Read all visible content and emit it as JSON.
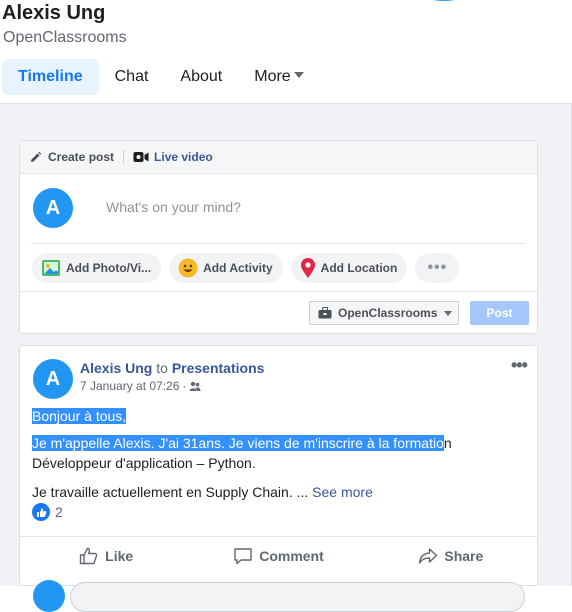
{
  "profile": {
    "name": "Alexis Ung",
    "page": "OpenClassrooms"
  },
  "tabs": [
    {
      "label": "Timeline",
      "active": true
    },
    {
      "label": "Chat"
    },
    {
      "label": "About"
    },
    {
      "label": "More"
    }
  ],
  "composer": {
    "create_post": "Create post",
    "live_video": "Live video",
    "avatar_letter": "A",
    "placeholder": "What's on your mind?",
    "chips": [
      "Add Photo/Vi...",
      "Add Activity",
      "Add Location"
    ],
    "more_chip": "•••",
    "page_selector": "OpenClassrooms",
    "post_button": "Post"
  },
  "post": {
    "avatar_letter": "A",
    "author": "Alexis Ung",
    "connector": "to",
    "target": "Presentations",
    "timestamp": "7 January at 07:26",
    "more_menu": "•••",
    "line1": "Bonjour à tous,",
    "line2_highlight": "Je m'appelle Alexis. J'ai 31ans. Je viens de m'inscrire à la formatio",
    "line2_rest": "n",
    "line3": "Développeur d'application – Python.",
    "line4": "Je travaille actuellement en Supply Chain. ...",
    "see_more": "See more",
    "like_count": "2",
    "actions": [
      "Like",
      "Comment",
      "Share"
    ]
  },
  "colors": {
    "accent": "#1877f2",
    "link": "#365899",
    "avatar": "#2196f3",
    "selection": "#3390ff",
    "background": "#f0f2f5"
  }
}
